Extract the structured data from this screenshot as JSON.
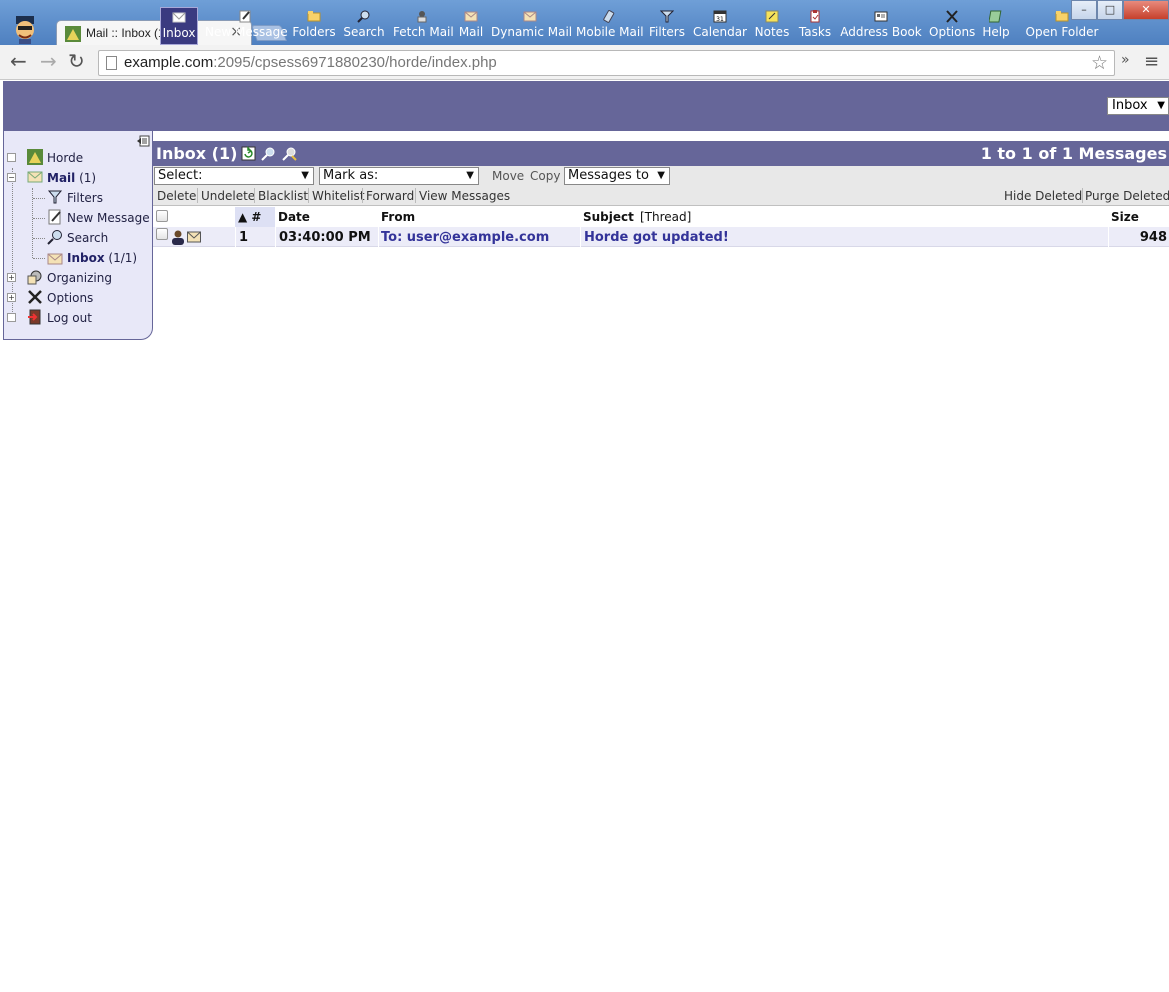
{
  "browser": {
    "tab_title": "Mail :: Inbox (1)",
    "tab_close": "×",
    "url_host": "example.com",
    "url_rest": ":2095/cpsess6971880230/horde/index.php",
    "win_min": "–",
    "win_max": "□",
    "win_close": "✕",
    "back": "←",
    "forward": "→",
    "reload": "↻",
    "star": "☆",
    "more": "»",
    "menu": "≡"
  },
  "menubar": {
    "items": [
      {
        "label": "Inbox",
        "icon": "inbox-icon",
        "active": true
      },
      {
        "label": "New Message",
        "icon": "new-message-icon"
      },
      {
        "label": "Folders",
        "icon": "folder-icon"
      },
      {
        "label": "Search",
        "icon": "search-icon"
      },
      {
        "label": "Fetch Mail",
        "icon": "fetch-mail-icon"
      },
      {
        "label": "Mail",
        "icon": "mail-icon"
      },
      {
        "label": "Dynamic Mail",
        "icon": "dynamic-mail-icon"
      },
      {
        "label": "Mobile Mail",
        "icon": "mobile-mail-icon"
      },
      {
        "label": "Filters",
        "icon": "filter-icon"
      },
      {
        "label": "Calendar",
        "icon": "calendar-icon"
      },
      {
        "label": "Notes",
        "icon": "notes-icon"
      },
      {
        "label": "Tasks",
        "icon": "tasks-icon"
      },
      {
        "label": "Address Book",
        "icon": "address-book-icon"
      },
      {
        "label": "Options",
        "icon": "options-icon"
      },
      {
        "label": "Help",
        "icon": "help-icon"
      },
      {
        "label": "Open Folder",
        "icon": "open-folder-icon"
      }
    ],
    "folder_select": "Inbox",
    "calendar_day": "31"
  },
  "sidebar": {
    "items": [
      {
        "label": "Horde",
        "count": ""
      },
      {
        "label": "Mail",
        "count": "(1)"
      },
      {
        "label": "Filters",
        "count": ""
      },
      {
        "label": "New Message",
        "count": ""
      },
      {
        "label": "Search",
        "count": ""
      },
      {
        "label": "Inbox",
        "count": "(1/1)"
      },
      {
        "label": "Organizing",
        "count": ""
      },
      {
        "label": "Options",
        "count": ""
      },
      {
        "label": "Log out",
        "count": ""
      }
    ]
  },
  "mailbox": {
    "title": "Inbox (1)",
    "range": "1 to 1 of 1 Messages",
    "select_label": "Select:",
    "markas_label": "Mark as:",
    "move_label": "Move",
    "copy_label": "Copy",
    "target_label": "Messages to",
    "links": {
      "delete": "Delete",
      "undelete": "Undelete",
      "blacklist": "Blacklist",
      "whitelist": "Whitelist",
      "forward": "Forward",
      "view": "View Messages",
      "hide_deleted": "Hide Deleted",
      "purge_deleted": "Purge Deleted"
    },
    "columns": {
      "num": "▲ #",
      "date": "Date",
      "from": "From",
      "subject": "Subject",
      "thread": "[Thread]",
      "size": "Size"
    },
    "messages": [
      {
        "num": "1",
        "date": "03:40:00 PM",
        "from": "To: user@example.com",
        "subject": "Horde got updated!",
        "size": "948"
      }
    ]
  }
}
